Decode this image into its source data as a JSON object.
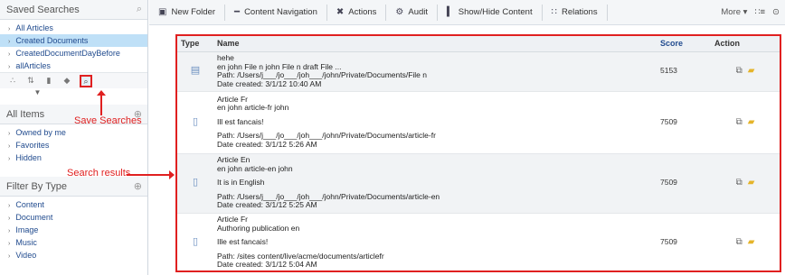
{
  "sidebar": {
    "saved_title": "Saved Searches",
    "saved_items": [
      "All Articles",
      "Created Documents",
      "CreatedDocumentDayBefore",
      "allArticles"
    ],
    "all_title": "All Items",
    "all_items": [
      "Owned by me",
      "Favorites",
      "Hidden"
    ],
    "type_title": "Filter By Type",
    "type_items": [
      "Content",
      "Document",
      "Image",
      "Music",
      "Video"
    ]
  },
  "annotations": {
    "save_searches": "Save Searches",
    "search_results": "Search results"
  },
  "toolbar": {
    "new_folder": "New Folder",
    "content_navigation": "Content Navigation",
    "actions": "Actions",
    "audit": "Audit",
    "show_hide": "Show/Hide Content",
    "relations": "Relations",
    "more": "More ▾"
  },
  "table": {
    "headers": {
      "type": "Type",
      "name": "Name",
      "score": "Score",
      "action": "Action"
    },
    "rows": [
      {
        "l1": "hehe",
        "l2": "en john File n john File n draft File ...",
        "l3": "Path: /Users/j___/jo___/joh___/john/Private/Documents/File n",
        "l4": "Date created: 3/1/12 10:40 AM",
        "score": "5153"
      },
      {
        "l1": "Article Fr",
        "l2": "en john article-fr john",
        "l3": "Ill est fancais!",
        "l4": "Path: /Users/j___/jo___/joh___/john/Private/Documents/article-fr",
        "l5": "Date created: 3/1/12 5:26 AM",
        "score": "7509"
      },
      {
        "l1": "Article En",
        "l2": "en john article-en john",
        "l3": "It is in English",
        "l4": "Path: /Users/j___/jo___/joh___/john/Private/Documents/article-en",
        "l5": "Date created: 3/1/12 5:25 AM",
        "score": "7509"
      },
      {
        "l1": "Article Fr",
        "l2": "Authoring publication en",
        "l3": "Ille est fancais!",
        "l4": "Path: /sites content/live/acme/documents/articlefr",
        "l5": "Date created: 3/1/12 5:04 AM",
        "score": "7509"
      }
    ]
  }
}
